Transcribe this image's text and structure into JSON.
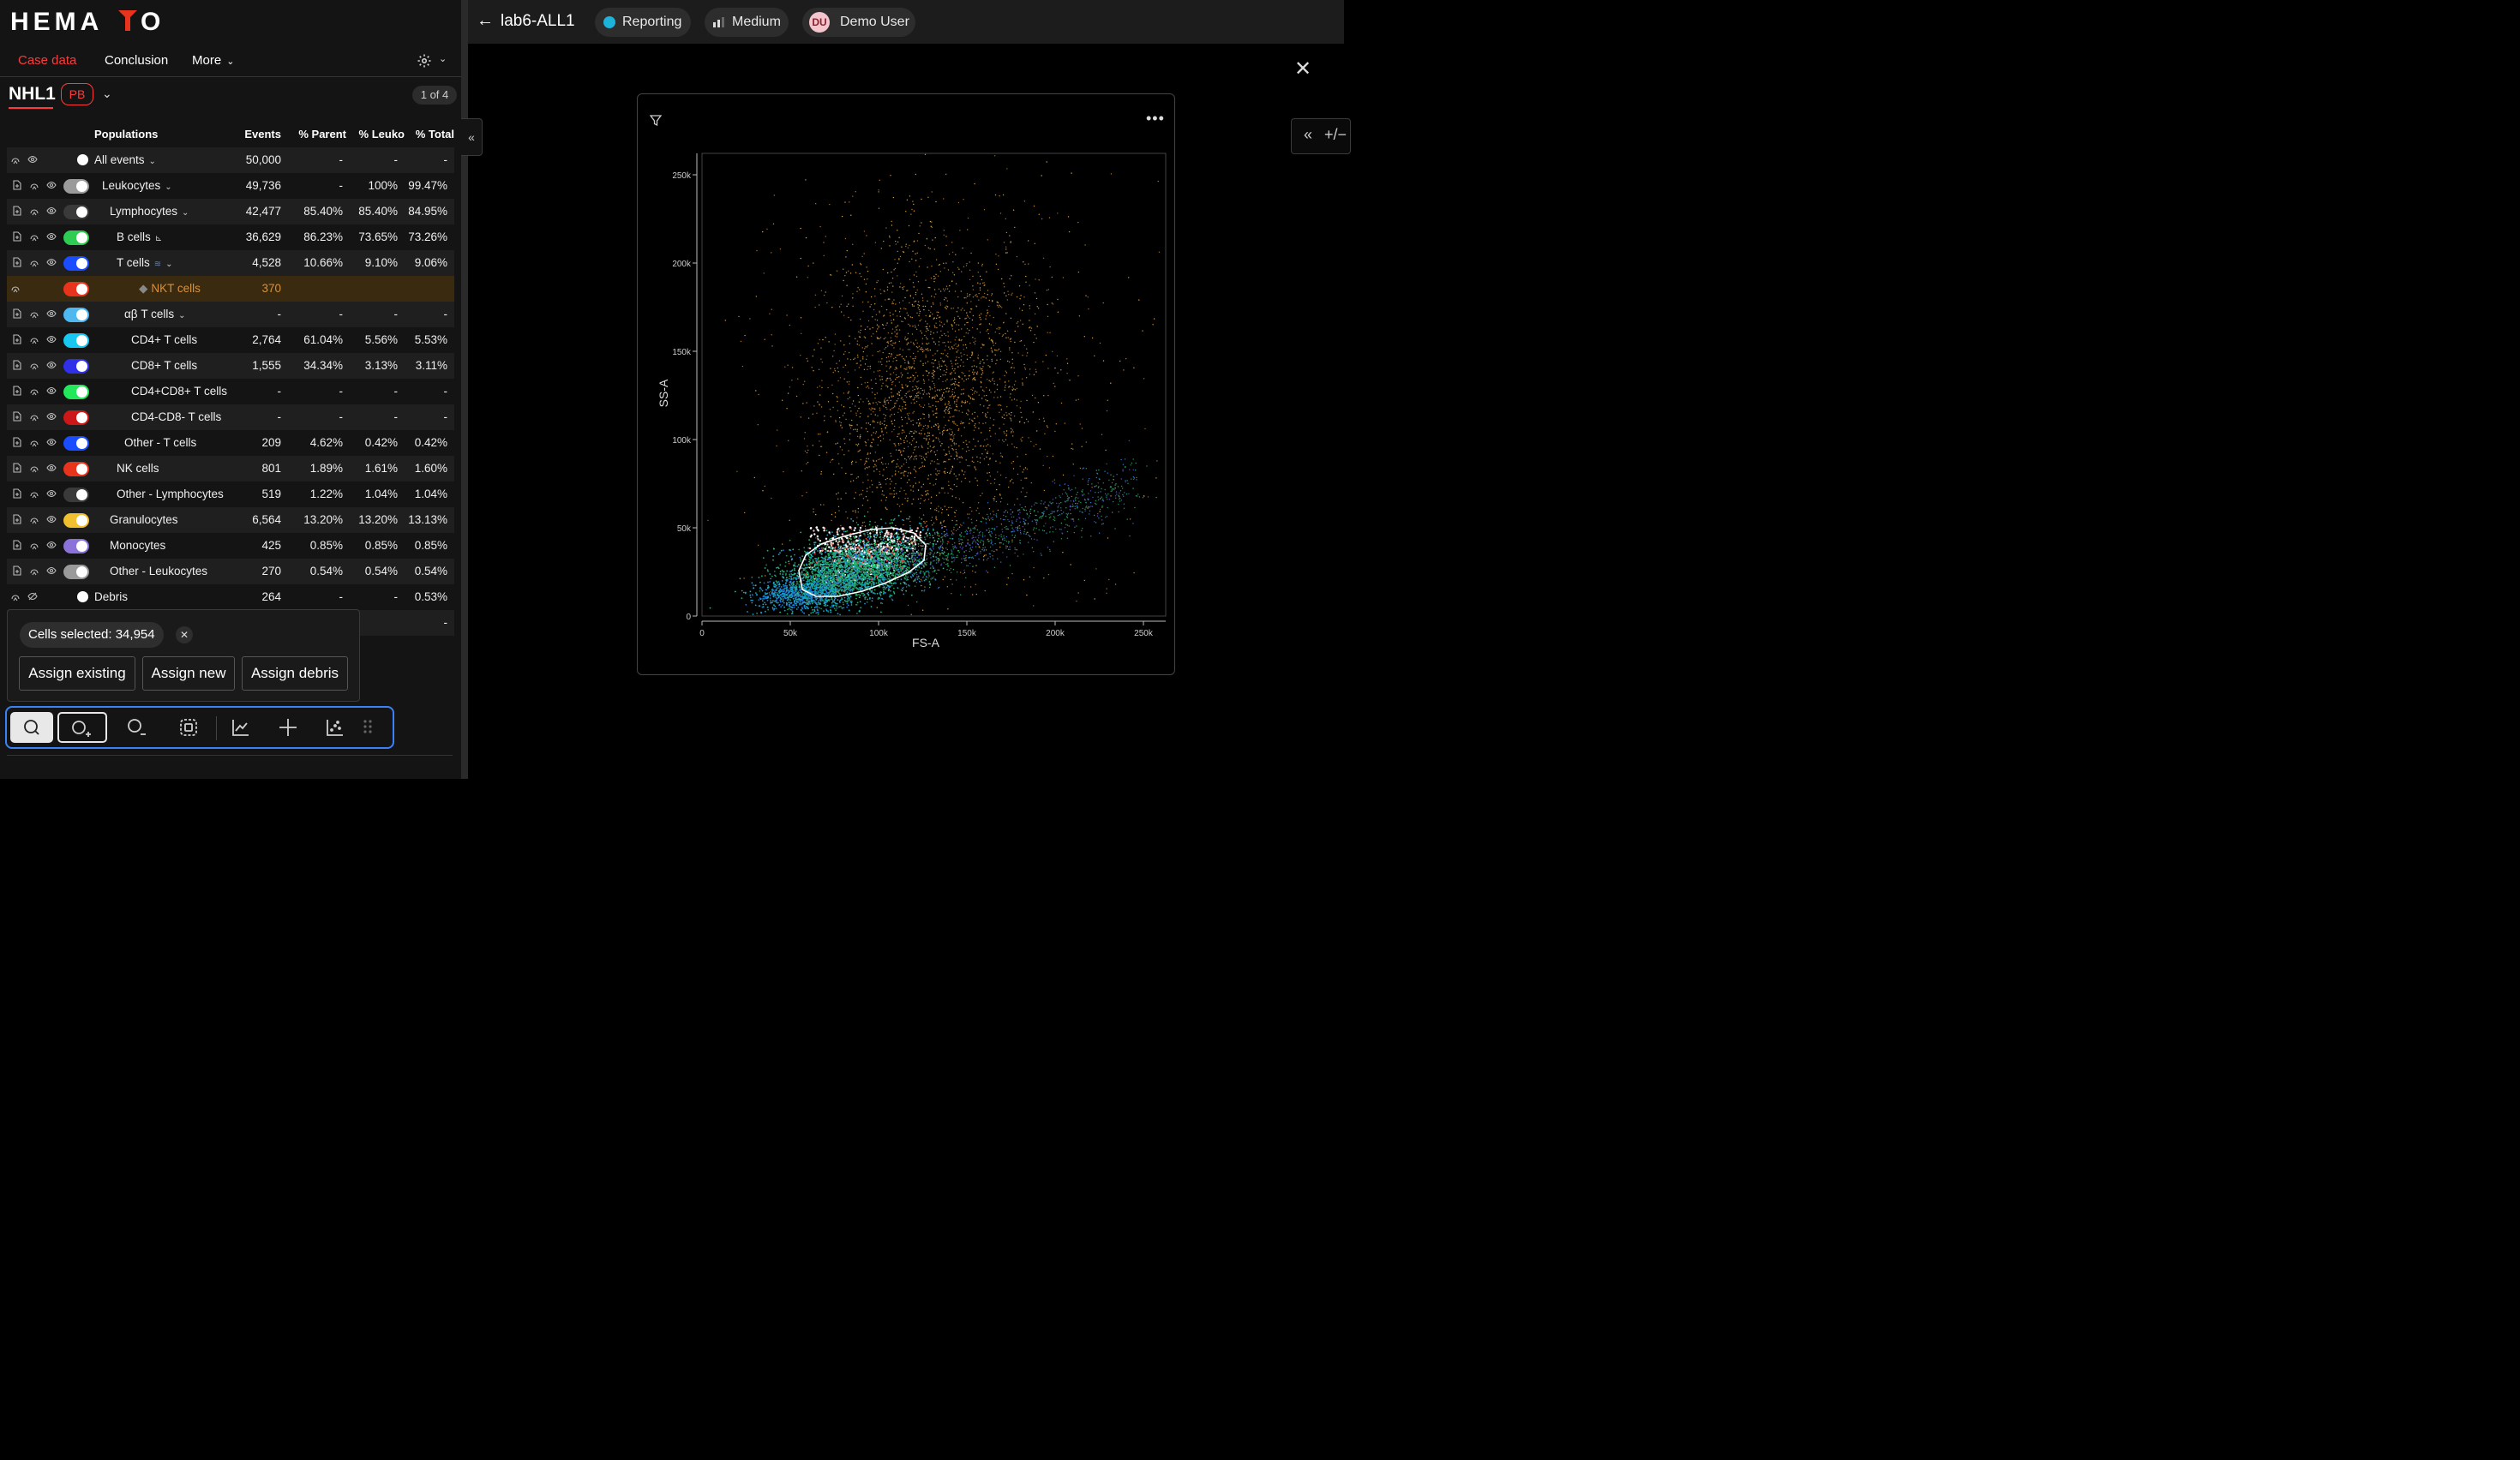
{
  "logo_text": "HEMATO",
  "nav": {
    "tabs": [
      "Case data",
      "Conclusion",
      "More"
    ]
  },
  "sample": {
    "name": "NHL1",
    "type_badge": "PB",
    "pager": "1 of 4"
  },
  "table": {
    "headers": [
      "Populations",
      "Events",
      "% Parent",
      "% Leuko",
      "% Total"
    ],
    "rows": [
      {
        "name": "All events",
        "events": "50,000",
        "parent": "-",
        "leuko": "-",
        "total": "-",
        "color": "#ffffff"
      },
      {
        "name": "Leukocytes",
        "events": "49,736",
        "parent": "-",
        "leuko": "100%",
        "total": "99.47%",
        "color": "#9a9a9a"
      },
      {
        "name": "Lymphocytes",
        "events": "42,477",
        "parent": "85.40%",
        "leuko": "85.40%",
        "total": "84.95%",
        "color": "#3a3a3a"
      },
      {
        "name": "B cells",
        "events": "36,629",
        "parent": "86.23%",
        "leuko": "73.65%",
        "total": "73.26%",
        "color": "#2ecc52"
      },
      {
        "name": "T cells",
        "events": "4,528",
        "parent": "10.66%",
        "leuko": "9.10%",
        "total": "9.06%",
        "color": "#1a4dff"
      },
      {
        "name": "NKT cells",
        "events": "370",
        "parent": "",
        "leuko": "",
        "total": "",
        "color": "#e8341c"
      },
      {
        "name": "αβ T cells",
        "events": "-",
        "parent": "-",
        "leuko": "-",
        "total": "-",
        "color": "#4fb8f0"
      },
      {
        "name": "CD4+ T cells",
        "events": "2,764",
        "parent": "61.04%",
        "leuko": "5.56%",
        "total": "5.53%",
        "color": "#18c8f0"
      },
      {
        "name": "CD8+ T cells",
        "events": "1,555",
        "parent": "34.34%",
        "leuko": "3.13%",
        "total": "3.11%",
        "color": "#3030e8"
      },
      {
        "name": "CD4+CD8+ T cells",
        "events": "-",
        "parent": "-",
        "leuko": "-",
        "total": "-",
        "color": "#22e85a"
      },
      {
        "name": "CD4-CD8- T cells",
        "events": "-",
        "parent": "-",
        "leuko": "-",
        "total": "-",
        "color": "#cc1818"
      },
      {
        "name": "Other - T cells",
        "events": "209",
        "parent": "4.62%",
        "leuko": "0.42%",
        "total": "0.42%",
        "color": "#1a4dff"
      },
      {
        "name": "NK cells",
        "events": "801",
        "parent": "1.89%",
        "leuko": "1.61%",
        "total": "1.60%",
        "color": "#e8341c"
      },
      {
        "name": "Other - Lymphocytes",
        "events": "519",
        "parent": "1.22%",
        "leuko": "1.04%",
        "total": "1.04%",
        "color": "#3a3a3a"
      },
      {
        "name": "Granulocytes",
        "events": "6,564",
        "parent": "13.20%",
        "leuko": "13.20%",
        "total": "13.13%",
        "color": "#f0c030"
      },
      {
        "name": "Monocytes",
        "events": "425",
        "parent": "0.85%",
        "leuko": "0.85%",
        "total": "0.85%",
        "color": "#8a72d8"
      },
      {
        "name": "Other - Leukocytes",
        "events": "270",
        "parent": "0.54%",
        "leuko": "0.54%",
        "total": "0.54%",
        "color": "#9a9a9a"
      },
      {
        "name": "Debris",
        "events": "264",
        "parent": "-",
        "leuko": "-",
        "total": "0.53%",
        "color": "#ffffff"
      },
      {
        "name": "",
        "events": "-",
        "parent": "-",
        "leuko": "",
        "total": "-",
        "color": ""
      }
    ]
  },
  "selection": {
    "chip": "Cells selected: 34,954",
    "buttons": [
      "Assign existing",
      "Assign new",
      "Assign debris"
    ]
  },
  "toolbar": {
    "tools": [
      "lasso-select",
      "lasso-add",
      "lasso-subtract",
      "box-select",
      "axis-adjust",
      "crosshair",
      "scatter-view",
      "grid-view"
    ]
  },
  "header": {
    "case_title": "lab6-ALL1",
    "status": "Reporting",
    "status_color": "#1cb4d8",
    "priority": "Medium",
    "user_initials": "DU",
    "user_name": "Demo User"
  },
  "plot": {
    "x_label": "FS-A",
    "y_label": "SS-A",
    "x_ticks": [
      "0",
      "50k",
      "100k",
      "150k",
      "200k",
      "250k"
    ],
    "y_ticks": [
      "0",
      "50k",
      "100k",
      "150k",
      "200k",
      "250k"
    ]
  },
  "side_tools": {
    "collapse_glyph": "«",
    "toggle_glyph": "+/−"
  }
}
